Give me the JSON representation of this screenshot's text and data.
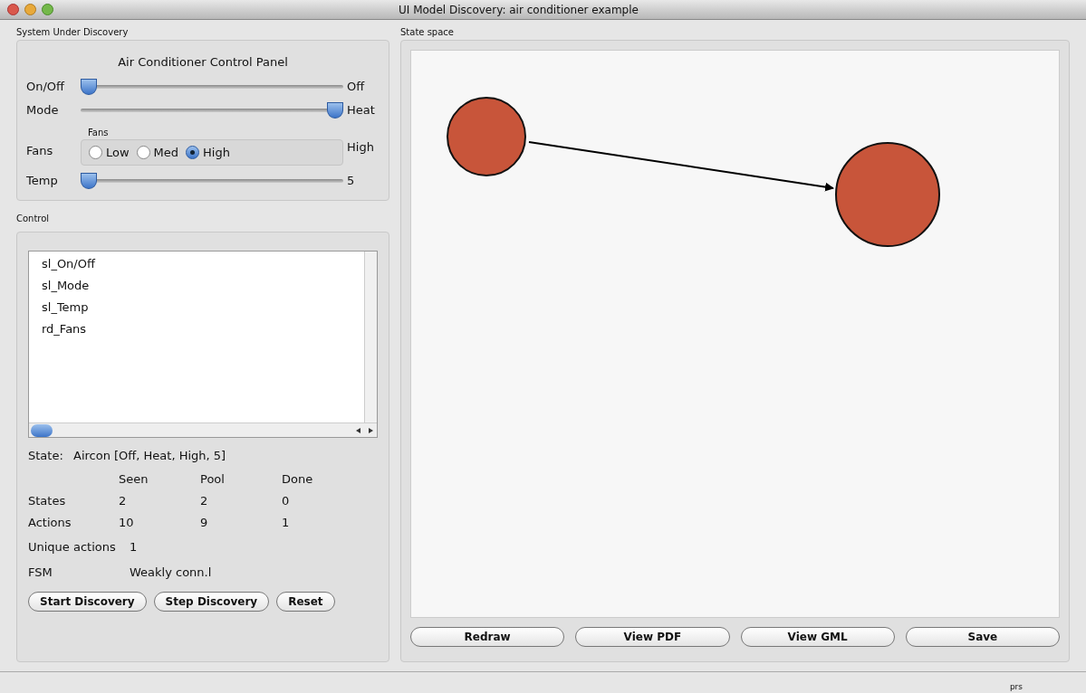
{
  "window": {
    "title": "UI Model Discovery: air conditioner example"
  },
  "system_panel": {
    "title": "System Under Discovery",
    "heading": "Air Conditioner Control Panel",
    "controls": [
      {
        "kind": "slider",
        "label": "On/Off",
        "level": 0,
        "reading": "Off"
      },
      {
        "kind": "slider",
        "label": "Mode",
        "level": 1,
        "reading": "Heat"
      },
      {
        "kind": "radio",
        "label": "Fans",
        "group_title": "Fans",
        "options": [
          {
            "label": "Low",
            "selected": false
          },
          {
            "label": "Med",
            "selected": false
          },
          {
            "label": "High",
            "selected": true
          }
        ],
        "reading": "High"
      },
      {
        "kind": "slider",
        "label": "Temp",
        "level": 0,
        "reading": "5"
      }
    ]
  },
  "control_panel": {
    "title": "Control",
    "items": [
      "sl_On/Off",
      "sl_Mode",
      "sl_Temp",
      "rd_Fans"
    ],
    "state_label": "State:",
    "state_value": "Aircon [Off, Heat, High, 5]",
    "table": {
      "columns": [
        "",
        "Seen",
        "Pool",
        "Done"
      ],
      "rows": [
        [
          "States",
          "2",
          "2",
          "0"
        ],
        [
          "Actions",
          "10",
          "9",
          "1"
        ]
      ]
    },
    "facts": [
      {
        "label": "Unique actions",
        "value": "1"
      },
      {
        "label": "FSM",
        "value": "Weakly conn.l"
      }
    ],
    "buttons": [
      "Start Discovery",
      "Step Discovery",
      "Reset"
    ]
  },
  "state_space": {
    "title": "State space",
    "buttons": [
      "Redraw",
      "View PDF",
      "View GML",
      "Save"
    ]
  },
  "status_bar": {
    "text": "prs"
  }
}
